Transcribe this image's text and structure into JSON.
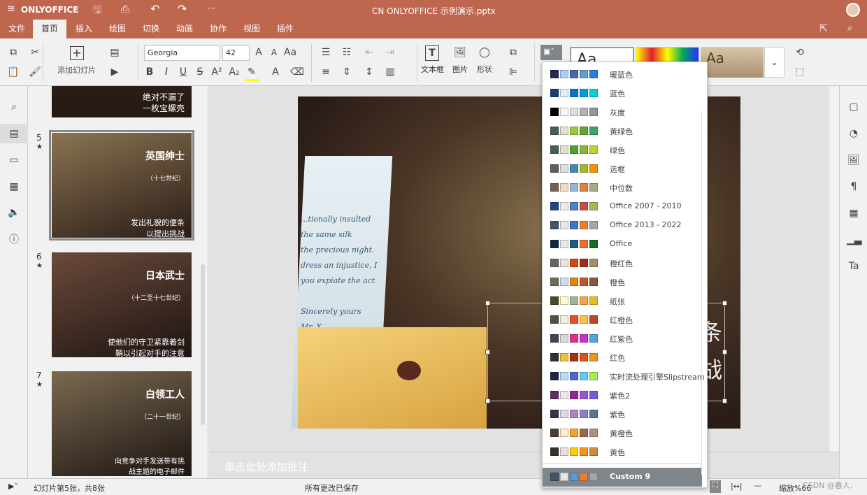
{
  "app": {
    "logo": "ONLYOFFICE",
    "title": "CN  ONLYOFFICE 示例演示.pptx"
  },
  "tabs": [
    "文件",
    "首页",
    "插入",
    "绘图",
    "切换",
    "动画",
    "协作",
    "视图",
    "插件"
  ],
  "toolbar": {
    "font": "Georgia",
    "size": "42",
    "add_slide": "添加幻灯片",
    "textbox": "文本框",
    "picture": "图片",
    "shape": "形状",
    "theme_preview": "Aa"
  },
  "thumbs": [
    {
      "num": "",
      "title": "",
      "sub": "",
      "body": "绝对不漏了\n一枚宝螺壳"
    },
    {
      "num": "5",
      "title": "英国绅士",
      "sub": "（十七世纪）",
      "body": "发出礼貌的便条\n以提出挑战"
    },
    {
      "num": "6",
      "title": "日本武士",
      "sub": "（十二至十七世纪）",
      "body": "使他们的守卫紧靠着剑\n鞘以引起对手的注意"
    },
    {
      "num": "7",
      "title": "白领工人",
      "sub": "（二十一世纪）",
      "body": "向竞争对手发送带有挑\n战主题的电子邮件"
    }
  ],
  "slide": {
    "letter": "...tionally insulted\nthe same silk\nthe precious night.\ndress an injustice, I\nyou expiate the act\n\nSincerely yours\nMr. X",
    "big_text": "条\n战"
  },
  "notes_placeholder": "单击此处添加批注",
  "status": {
    "slide_info": "幻灯片第5张，共8张",
    "saved": "所有更改已保存",
    "zoom": "缩放%66",
    "watermark": "CSDN @春人."
  },
  "color_schemes": [
    {
      "name": "暖蓝色",
      "colors": [
        "#242852",
        "#acccf6",
        "#4a66ac",
        "#629dd1",
        "#297fd5"
      ]
    },
    {
      "name": "蓝色",
      "colors": [
        "#17406d",
        "#dbeff9",
        "#0f6fc6",
        "#009dd9",
        "#0bd0d9"
      ]
    },
    {
      "name": "灰度",
      "colors": [
        "#000000",
        "#f8f8f8",
        "#dddddd",
        "#b2b2b2",
        "#969696"
      ]
    },
    {
      "name": "黄绿色",
      "colors": [
        "#455f51",
        "#e3ded1",
        "#99cb38",
        "#63a537",
        "#37a76f"
      ]
    },
    {
      "name": "绿色",
      "colors": [
        "#455f51",
        "#e3ded1",
        "#549e39",
        "#8ab833",
        "#c0cf3a"
      ]
    },
    {
      "name": "选框",
      "colors": [
        "#5e5e5e",
        "#dddddd",
        "#418ab3",
        "#a6b727",
        "#f69200"
      ]
    },
    {
      "name": "中位数",
      "colors": [
        "#775f55",
        "#ebddc3",
        "#94b6d2",
        "#dd8047",
        "#a5ab81"
      ]
    },
    {
      "name": "Office 2007 - 2010",
      "colors": [
        "#1f497d",
        "#eeece1",
        "#4f81bd",
        "#c0504d",
        "#9bbb59"
      ]
    },
    {
      "name": "Office 2013 - 2022",
      "colors": [
        "#44546a",
        "#e7e6e6",
        "#4472c4",
        "#ed7d31",
        "#a5a5a5"
      ]
    },
    {
      "name": "Office",
      "colors": [
        "#0e2841",
        "#e8e8e8",
        "#156082",
        "#e97132",
        "#196b24"
      ]
    },
    {
      "name": "橙红色",
      "colors": [
        "#696464",
        "#e9e5dc",
        "#d34817",
        "#9b2d1f",
        "#a28e6a"
      ]
    },
    {
      "name": "橙色",
      "colors": [
        "#637052",
        "#ccddea",
        "#e48312",
        "#bd582c",
        "#865640"
      ]
    },
    {
      "name": "纸张",
      "colors": [
        "#444d26",
        "#fefac9",
        "#a5b592",
        "#f3a447",
        "#e7bc29"
      ]
    },
    {
      "name": "红橙色",
      "colors": [
        "#505046",
        "#eeece1",
        "#e84c22",
        "#ffbd47",
        "#b64926"
      ]
    },
    {
      "name": "红紫色",
      "colors": [
        "#454551",
        "#d8d9dc",
        "#e32d91",
        "#c830cc",
        "#4ea6dc"
      ]
    },
    {
      "name": "红色",
      "colors": [
        "#323232",
        "#e5c243",
        "#a5300f",
        "#d55816",
        "#e19825"
      ]
    },
    {
      "name": "实时流处理引擎Slipstream",
      "colors": [
        "#212745",
        "#b4dcfa",
        "#4e67c8",
        "#5eccf3",
        "#a7ea52"
      ]
    },
    {
      "name": "紫色2",
      "colors": [
        "#632e62",
        "#eae5eb",
        "#92278f",
        "#9b57d3",
        "#755dd9"
      ]
    },
    {
      "name": "紫色",
      "colors": [
        "#373545",
        "#dcd8dc",
        "#ad84c6",
        "#8784c7",
        "#5d739a"
      ]
    },
    {
      "name": "黄橙色",
      "colors": [
        "#4e3b30",
        "#fbeec9",
        "#f0a22e",
        "#a5644e",
        "#b58b80"
      ]
    },
    {
      "name": "黄色",
      "colors": [
        "#39302a",
        "#e5dedb",
        "#ffca08",
        "#f8931d",
        "#ce8d3e"
      ]
    }
  ],
  "custom_scheme": {
    "name": "Custom 9",
    "colors": [
      "#44546a",
      "#e7e6e6",
      "#5b9bd5",
      "#ed7d31",
      "#a5a5a5"
    ],
    "selected": true
  },
  "accent": "#bf664f"
}
